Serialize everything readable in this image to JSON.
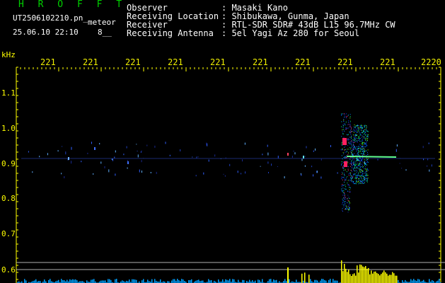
{
  "app": {
    "title": "H R O F F T"
  },
  "file": {
    "name": "UT2506102210.pn_",
    "type": "meteor",
    "datetime": "25.06.10 22:10",
    "count": "8__"
  },
  "header": [
    {
      "label": "Observer",
      "value": ": Masaki Kano"
    },
    {
      "label": "Receiving Location",
      "value": ": Shibukawa, Gunma, Japan"
    },
    {
      "label": "Receiver",
      "value": ": RTL-SDR SDR# 43dB L15 96.7MHz CW"
    },
    {
      "label": "Receiving Antenna",
      "value": ": 5el Yagi Az 280 for Seoul"
    }
  ],
  "axes": {
    "y_unit": "kHz",
    "x_ticks": [
      "221",
      "221",
      "221",
      "221",
      "221",
      "221",
      "221",
      "221",
      "221",
      "2220"
    ],
    "y_ticks": [
      "1.1",
      "1.0",
      "0.9",
      "0.8",
      "0.7",
      "0.6"
    ]
  },
  "colors": {
    "title": "#00d000",
    "ticks": "#ffff00",
    "text": "#ffffff",
    "bg": "#000000"
  }
}
